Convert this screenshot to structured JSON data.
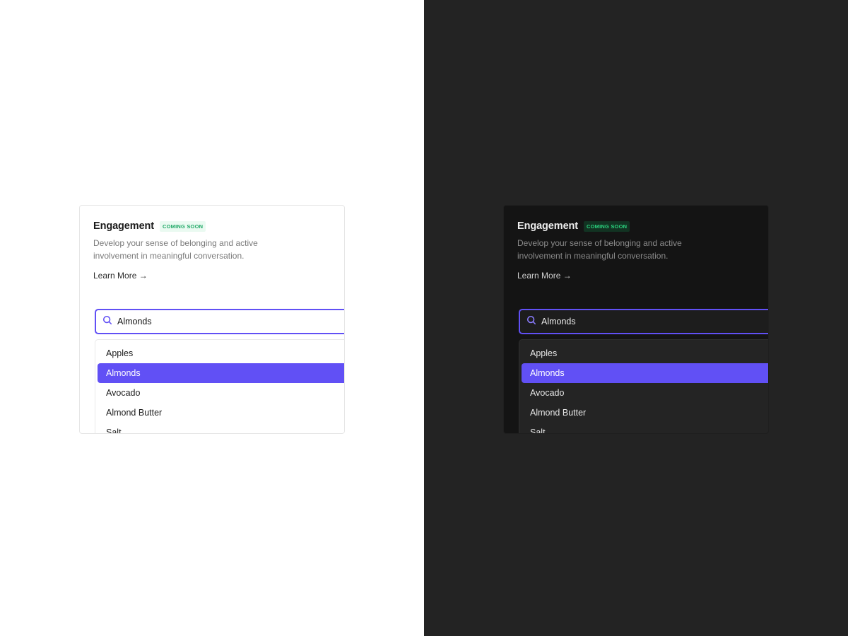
{
  "colors": {
    "accent": "#6150f5",
    "badge_text": "#1fa866",
    "light_background": "#ffffff",
    "dark_background": "#232323",
    "dark_card": "#141414"
  },
  "panel": {
    "title": "Engagement",
    "badge": "COMING SOON",
    "description": "Develop your sense of belonging and active involvement in meaningful conversation.",
    "learn_more": "Learn More →"
  },
  "search": {
    "icon": "search-icon",
    "value": "Almonds"
  },
  "list": {
    "items": [
      {
        "label": "Apples"
      },
      {
        "label": "Almonds"
      },
      {
        "label": "Avocado"
      },
      {
        "label": "Almond Butter"
      },
      {
        "label": "Salt"
      }
    ],
    "selected_index": 1
  }
}
